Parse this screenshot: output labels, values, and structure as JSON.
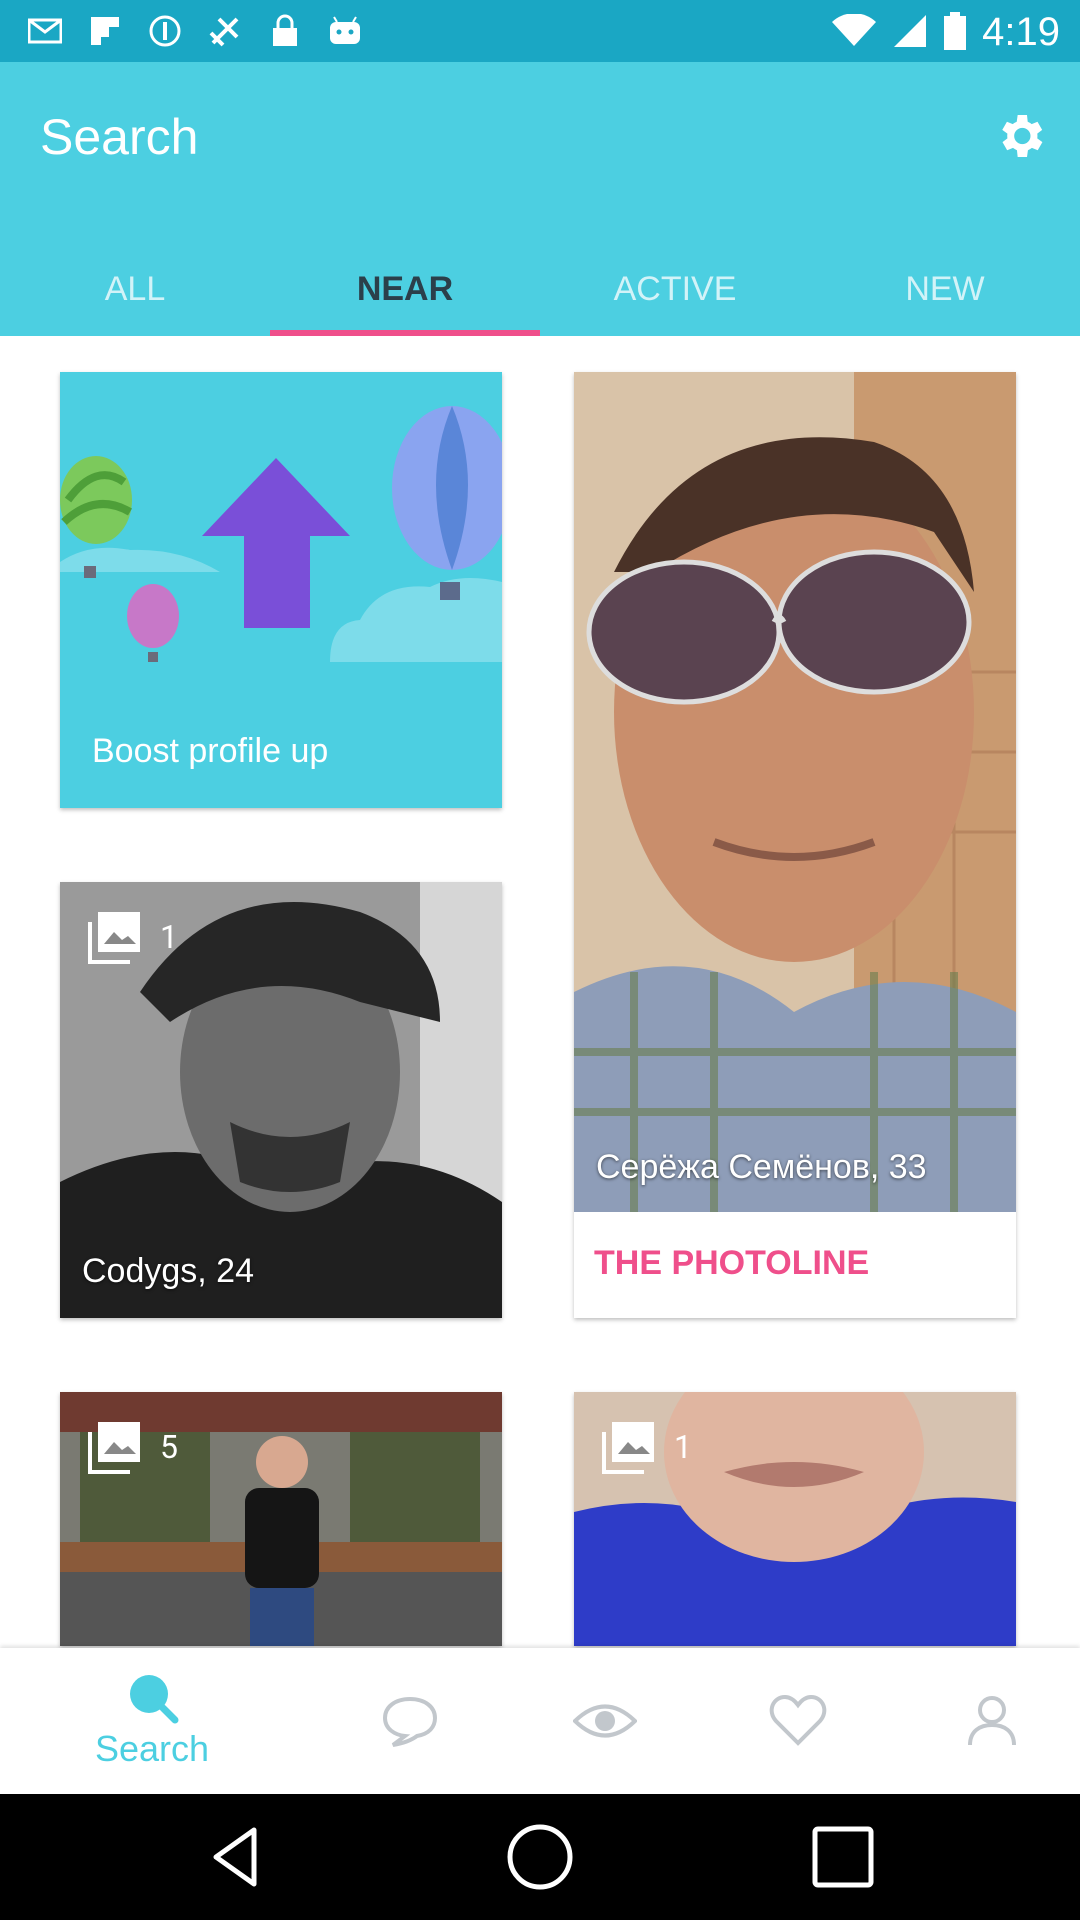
{
  "status_bar": {
    "time": "4:19",
    "left_icons": [
      "mail-icon",
      "flipboard-icon",
      "info-icon",
      "fake-gps-icon",
      "lock-icon",
      "android-icon"
    ],
    "right_icons": [
      "wifi-icon",
      "signal-icon",
      "battery-icon"
    ]
  },
  "header": {
    "title": "Search",
    "settings_icon": "gear-icon"
  },
  "tabs": [
    {
      "label": "ALL"
    },
    {
      "label": "NEAR"
    },
    {
      "label": "ACTIVE"
    },
    {
      "label": "NEW"
    }
  ],
  "active_tab": "NEAR",
  "cards": {
    "boost": {
      "label": "Boost profile up"
    },
    "sergey": {
      "name": "Серёжа Семёнов, 33",
      "photoline": "THE PHOTOLINE"
    },
    "cody": {
      "photo_count": "1",
      "name": "Codygs, 24"
    },
    "card5": {
      "photo_count": "5"
    },
    "card6": {
      "photo_count": "1"
    }
  },
  "bottom_nav": {
    "search_label": "Search",
    "items": [
      "search-icon",
      "chat-icon",
      "eye-icon",
      "heart-icon",
      "profile-icon"
    ]
  },
  "colors": {
    "primary": "#4ccfe1",
    "status_bar": "#1aa7c4",
    "accent": "#ef4f8b",
    "active_tab_text": "#2b3f4a"
  }
}
